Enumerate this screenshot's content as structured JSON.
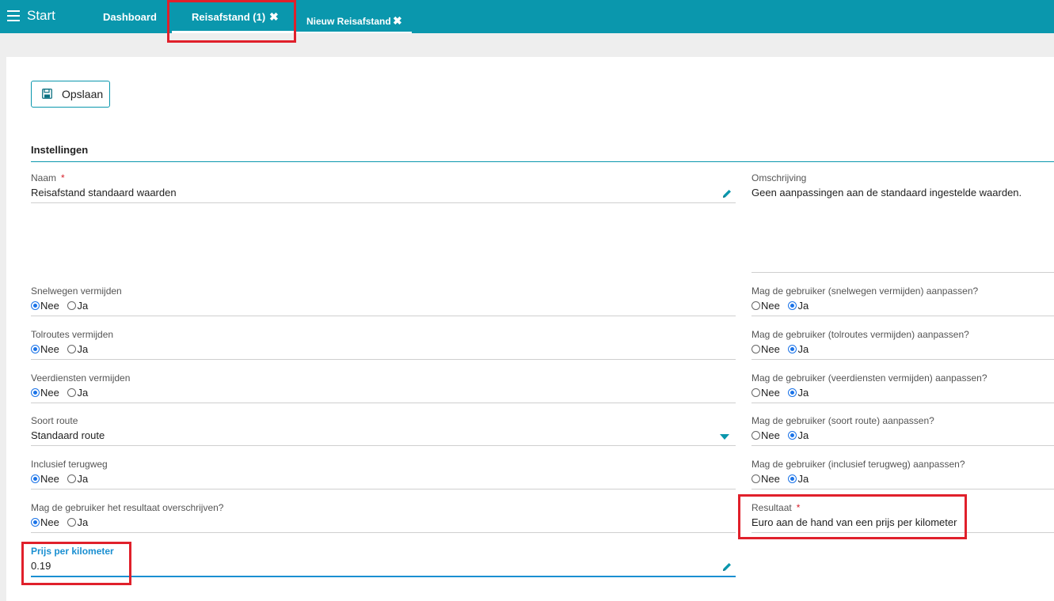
{
  "topbar": {
    "start_label": "Start",
    "tabs": [
      {
        "label": "Dashboard"
      },
      {
        "label": "Reisafstand (1)"
      },
      {
        "label": "Nieuw Reisafstand"
      }
    ]
  },
  "toolbar": {
    "save_label": "Opslaan"
  },
  "section": {
    "title": "Instellingen"
  },
  "form": {
    "naam": {
      "label": "Naam",
      "value": "Reisafstand standaard waarden",
      "required_mark": "*"
    },
    "omschrijving": {
      "label": "Omschrijving",
      "value": "Geen aanpassingen aan de standaard ingestelde waarden."
    },
    "snelwegen": {
      "label": "Snelwegen vermijden",
      "options": [
        "Nee",
        "Ja"
      ],
      "selected": "Nee"
    },
    "mag_snelwegen": {
      "label": "Mag de gebruiker (snelwegen vermijden) aanpassen?",
      "options": [
        "Nee",
        "Ja"
      ],
      "selected": "Ja"
    },
    "tolroutes": {
      "label": "Tolroutes vermijden",
      "options": [
        "Nee",
        "Ja"
      ],
      "selected": "Nee"
    },
    "mag_tolroutes": {
      "label": "Mag de gebruiker (tolroutes vermijden) aanpassen?",
      "options": [
        "Nee",
        "Ja"
      ],
      "selected": "Ja"
    },
    "veerdiensten": {
      "label": "Veerdiensten vermijden",
      "options": [
        "Nee",
        "Ja"
      ],
      "selected": "Nee"
    },
    "mag_veerdiensten": {
      "label": "Mag de gebruiker (veerdiensten vermijden) aanpassen?",
      "options": [
        "Nee",
        "Ja"
      ],
      "selected": "Ja"
    },
    "soort_route": {
      "label": "Soort route",
      "value": "Standaard route"
    },
    "mag_soort_route": {
      "label": "Mag de gebruiker (soort route) aanpassen?",
      "options": [
        "Nee",
        "Ja"
      ],
      "selected": "Ja"
    },
    "terugweg": {
      "label": "Inclusief terugweg",
      "options": [
        "Nee",
        "Ja"
      ],
      "selected": "Nee"
    },
    "mag_terugweg": {
      "label": "Mag de gebruiker (inclusief terugweg) aanpassen?",
      "options": [
        "Nee",
        "Ja"
      ],
      "selected": "Ja"
    },
    "resultaat_overschrijven": {
      "label": "Mag de gebruiker het resultaat overschrijven?",
      "options": [
        "Nee",
        "Ja"
      ],
      "selected": "Nee"
    },
    "resultaat": {
      "label": "Resultaat",
      "value": "Euro aan de hand van een prijs per kilometer",
      "required_mark": "*"
    },
    "prijs_km": {
      "label": "Prijs per kilometer",
      "value": "0.19"
    }
  },
  "colors": {
    "accent": "#0a97ad",
    "highlight": "#e0202b",
    "active": "#1a8fd1"
  },
  "icons": [
    "menu-icon",
    "close-icon",
    "floppy-disk-icon",
    "pencil-icon",
    "chevron-down-icon"
  ]
}
